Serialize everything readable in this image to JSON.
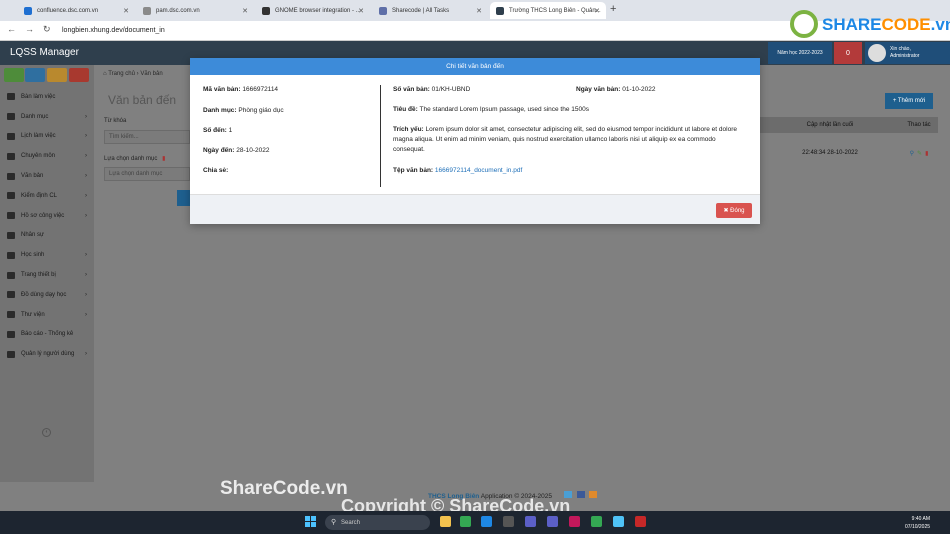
{
  "browser": {
    "tabs": [
      {
        "label": "confluence.dsc.com.vn",
        "active": false
      },
      {
        "label": "pam.dsc.com.vn",
        "active": false
      },
      {
        "label": "GNOME browser integration - ...",
        "active": false
      },
      {
        "label": "Sharecode | All Tasks",
        "active": false
      },
      {
        "label": "Trường THCS Long Biên - Quản...",
        "active": true
      }
    ],
    "url": "longbien.xhung.dev/document_in"
  },
  "header": {
    "logo": "LQSS Manager",
    "school_year": "Năm học 2022-2023",
    "notif_count": "0",
    "user_greeting": "Xin chào,",
    "user_name": "Administrator"
  },
  "sidebar": {
    "items": [
      {
        "label": "Bàn làm việc",
        "chevron": false
      },
      {
        "label": "Danh mục",
        "chevron": true
      },
      {
        "label": "Lịch làm việc",
        "chevron": true
      },
      {
        "label": "Chuyên môn",
        "chevron": true
      },
      {
        "label": "Văn bản",
        "chevron": true
      },
      {
        "label": "Kiểm định CL",
        "chevron": true
      },
      {
        "label": "Hồ sơ công việc",
        "chevron": true
      },
      {
        "label": "Nhân sự",
        "chevron": false
      },
      {
        "label": "Học sinh",
        "chevron": true
      },
      {
        "label": "Trang thiết bị",
        "chevron": true
      },
      {
        "label": "Đồ dùng dạy học",
        "chevron": true
      },
      {
        "label": "Thư viện",
        "chevron": true
      },
      {
        "label": "Báo cáo - Thống kê",
        "chevron": false
      },
      {
        "label": "Quản lý người dùng",
        "chevron": true
      }
    ],
    "chevron_glyph": "›"
  },
  "main": {
    "breadcrumb_home": "Trang chủ",
    "breadcrumb_sep": "›",
    "breadcrumb_current": "Văn bản",
    "page_title": "Văn bản đến",
    "keyword_label": "Từ khóa",
    "keyword_placeholder": "Tìm kiếm...",
    "category_label": "Lựa chọn danh mục",
    "category_placeholder": "Lựa chọn danh mục",
    "add_button": "+ Thêm mới",
    "col_updated": "Cập nhật lần cuối",
    "col_actions": "Thao tác",
    "row_updated": "22:48:34 28-10-2022"
  },
  "modal": {
    "title": "Chi tiết văn bản đến",
    "left": [
      {
        "label": "Mã văn bản:",
        "value": "1666972114"
      },
      {
        "label": "Danh mục:",
        "value": "Phòng giáo dục"
      },
      {
        "label": "Số đến:",
        "value": "1"
      },
      {
        "label": "Ngày đến:",
        "value": "28-10-2022"
      },
      {
        "label": "Chia sẻ:",
        "value": ""
      }
    ],
    "so_van_ban_label": "Số văn bản:",
    "so_van_ban_value": "01/KH-UBND",
    "ngay_van_ban_label": "Ngày văn bản:",
    "ngay_van_ban_value": "01-10-2022",
    "tieu_de_label": "Tiêu đề:",
    "tieu_de_value": "The standard Lorem Ipsum passage, used since the 1500s",
    "trich_yeu_label": "Trích yếu:",
    "trich_yeu_value": "Lorem ipsum dolor sit amet, consectetur adipiscing elit, sed do eiusmod tempor incididunt ut labore et dolore magna aliqua. Ut enim ad minim veniam, quis nostrud exercitation ullamco laboris nisi ut aliquip ex ea commodo consequat.",
    "tep_label": "Tệp văn bản:",
    "tep_value": "1666972114_document_in.pdf",
    "close_button": "✖ Đóng"
  },
  "footer": {
    "school": "THCS Long Biên",
    "text": "Application © 2024-2025"
  },
  "taskbar": {
    "search_placeholder": "Search",
    "time": "9:40 AM",
    "date": "07/10/2025"
  },
  "watermark": {
    "main": "ShareCode.vn",
    "copyright": "Copyright © ShareCode.vn",
    "logo_share": "SHARE",
    "logo_code": "CODE",
    "logo_tld": ".vn"
  }
}
